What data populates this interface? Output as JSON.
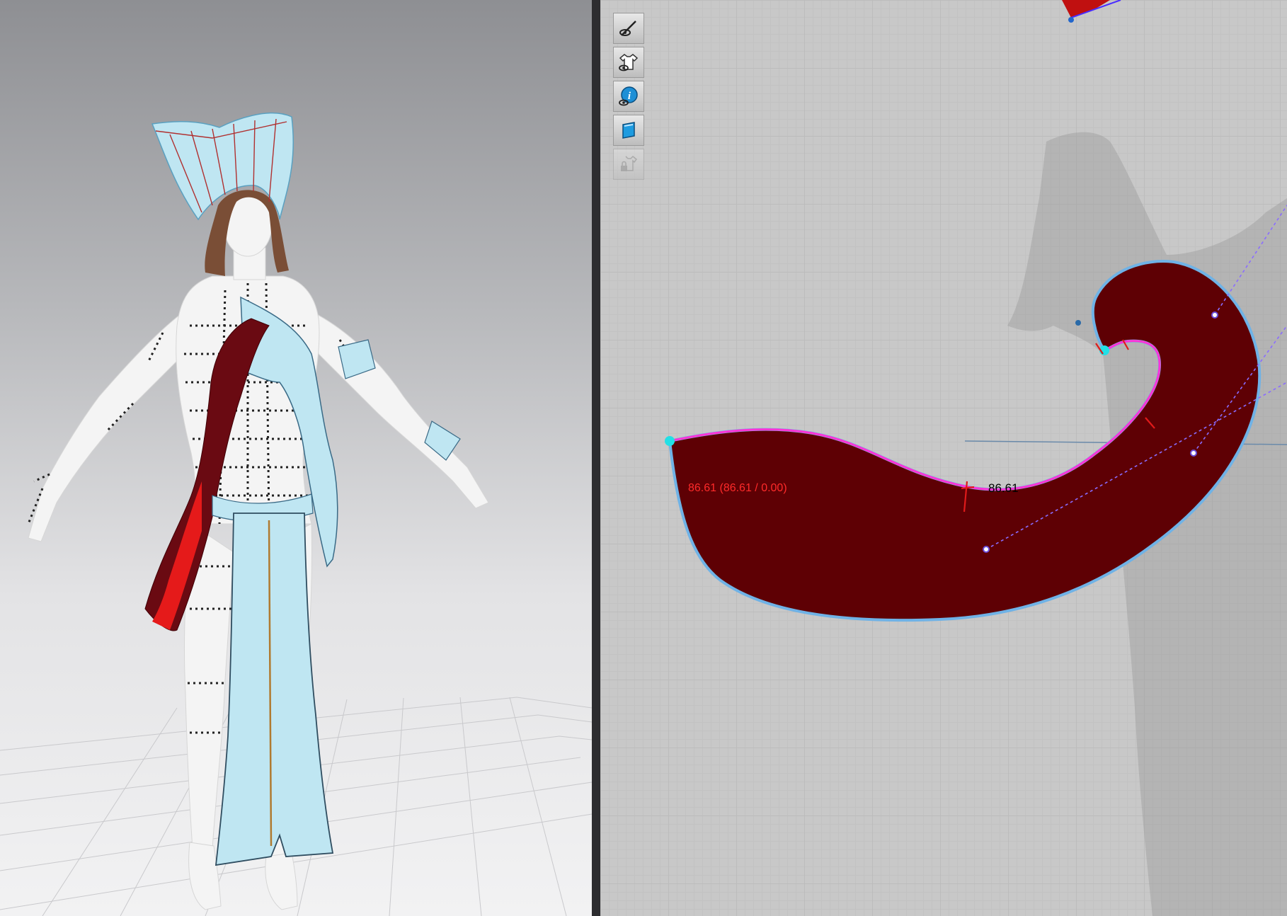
{
  "viewport_3d": {
    "label": ""
  },
  "viewport_2d": {
    "toolbar": {
      "items": [
        {
          "name": "show-pattern-icon",
          "label": ""
        },
        {
          "name": "show-garment-icon",
          "label": ""
        },
        {
          "name": "info-icon",
          "label": ""
        },
        {
          "name": "texture-icon",
          "label": ""
        },
        {
          "name": "lock-garment-icon",
          "label": ""
        }
      ]
    },
    "segment_measurement": "86.61 (86.61 / 0.00)",
    "segment_length": "86.61"
  },
  "colors": {
    "pattern_fill": "#5e0004",
    "selected_edge": "#ff33d6",
    "outline": "#6fb2e6",
    "fabric_blue": "#bfe6f2",
    "fabric_red": "#6a0a12"
  }
}
